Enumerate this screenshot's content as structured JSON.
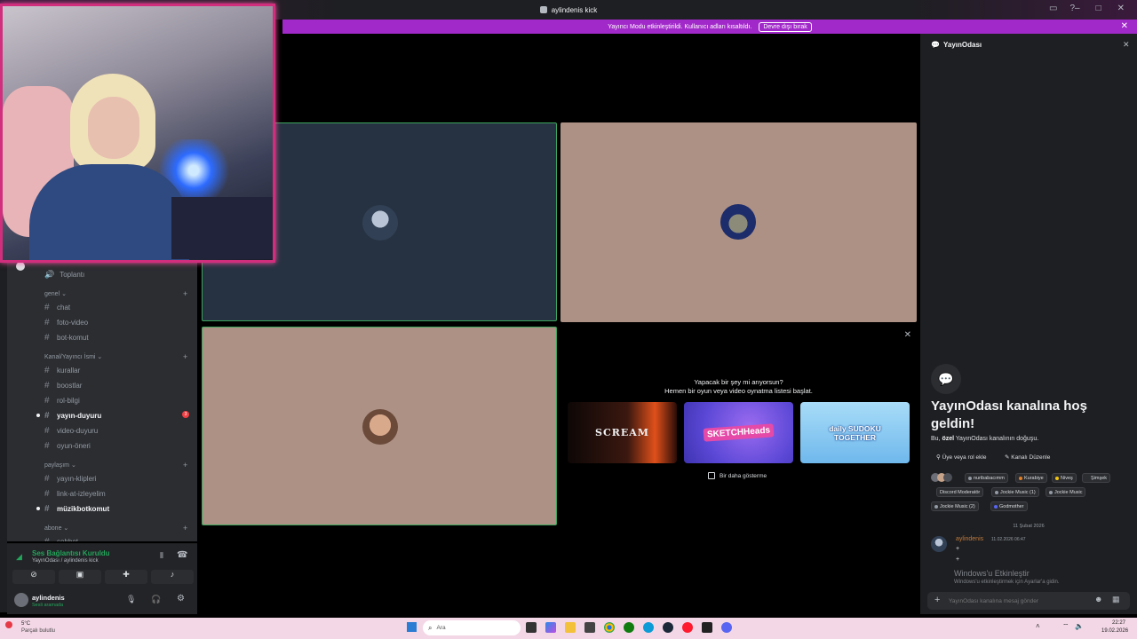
{
  "window": {
    "title": "aylindenis kick"
  },
  "banner": {
    "message": "Yayıncı Modu etkinleştirildi. Kullanıcı adları kısaltıldı.",
    "button_label": "Devre dışı bırak"
  },
  "sidebar": {
    "voice_channel": "Toplantı",
    "categories": [
      {
        "label": "genel",
        "channels": [
          "chat",
          "foto-video",
          "bot-komut"
        ]
      },
      {
        "label": "Kanal/Yayıncı İsmi",
        "channels": [
          "kurallar",
          "boostlar",
          "rol-bilgi",
          "yayın-duyuru",
          "video-duyuru",
          "oyun-öneri"
        ]
      },
      {
        "label": "paylaşım",
        "channels": [
          "yayın-klipleri",
          "link-at-izleyelim",
          "müzikbotkomut"
        ]
      },
      {
        "label": "abone",
        "channels": [
          "sohbet"
        ]
      }
    ],
    "unread_badge": "3"
  },
  "voice_panel": {
    "status": "Ses Bağlantısı Kuruldu",
    "location": "YayınOdası / aylindenis kick"
  },
  "user_panel": {
    "username": "aylindenis",
    "status": "Sesli aramada"
  },
  "activity": {
    "title": "Yapacak bir şey mi arıyorsun?",
    "subtitle": "Hemen bir oyun veya video oynatma listesi başlat.",
    "games": [
      {
        "name": "SCREAM",
        "bg": "#1a0f0c"
      },
      {
        "name": "SKETCHHeads",
        "bg": "#5b48d6"
      },
      {
        "name": "daily SUDOKU TOGETHER",
        "bg": "#7cc4f2"
      }
    ],
    "dont_show_label": "Bir daha gösterme"
  },
  "chat": {
    "channel_name": "YayınOdası",
    "welcome_title": "YayınOdası kanalına hoş geldin!",
    "welcome_prefix": "Bu, ",
    "welcome_bold": "özel",
    "welcome_suffix": " YayınOdası kanalının doğuşu.",
    "add_members": "Üye veya rol ekle",
    "edit_channel": "Kanalı Düzenle",
    "roles": [
      {
        "label": "nuribabacımm",
        "color": "#949ba4"
      },
      {
        "label": "Kurabiye",
        "color": "#e67e22"
      },
      {
        "label": "Niveş",
        "color": "#f1c40f"
      },
      {
        "label": "Şimşek",
        "color": "#2b2d31"
      },
      {
        "label": "Discord Moderatör",
        "color": "#2b2d31"
      },
      {
        "label": "Jockie Music (1)",
        "color": "#949ba4"
      },
      {
        "label": "Jockie Music",
        "color": "#949ba4"
      },
      {
        "label": "Jockie Music (2)",
        "color": "#949ba4"
      },
      {
        "label": "Godmother",
        "color": "#5865f2"
      }
    ],
    "date_divider": "11 Şubat 2026",
    "message": {
      "author": "aylindenis",
      "timestamp": "11.02.2026 06:47",
      "lines": [
        "+",
        "+"
      ]
    },
    "input_placeholder": "YayınOdası kanalına mesaj gönder"
  },
  "watermark": {
    "title": "Windows'u Etkinleştir",
    "subtitle": "Windows'u etkinleştirmek için Ayarlar'a gidin."
  },
  "taskbar": {
    "weather_temp": "5°C",
    "weather_desc": "Parçalı bulutlu",
    "search_placeholder": "Ara",
    "time": "22:27",
    "date": "19.02.2026"
  },
  "colors": {
    "banner": "#a129c9",
    "speaking_border": "#3ba55d",
    "tile_dark": "#263241",
    "tile_tan": "#ad9184"
  }
}
